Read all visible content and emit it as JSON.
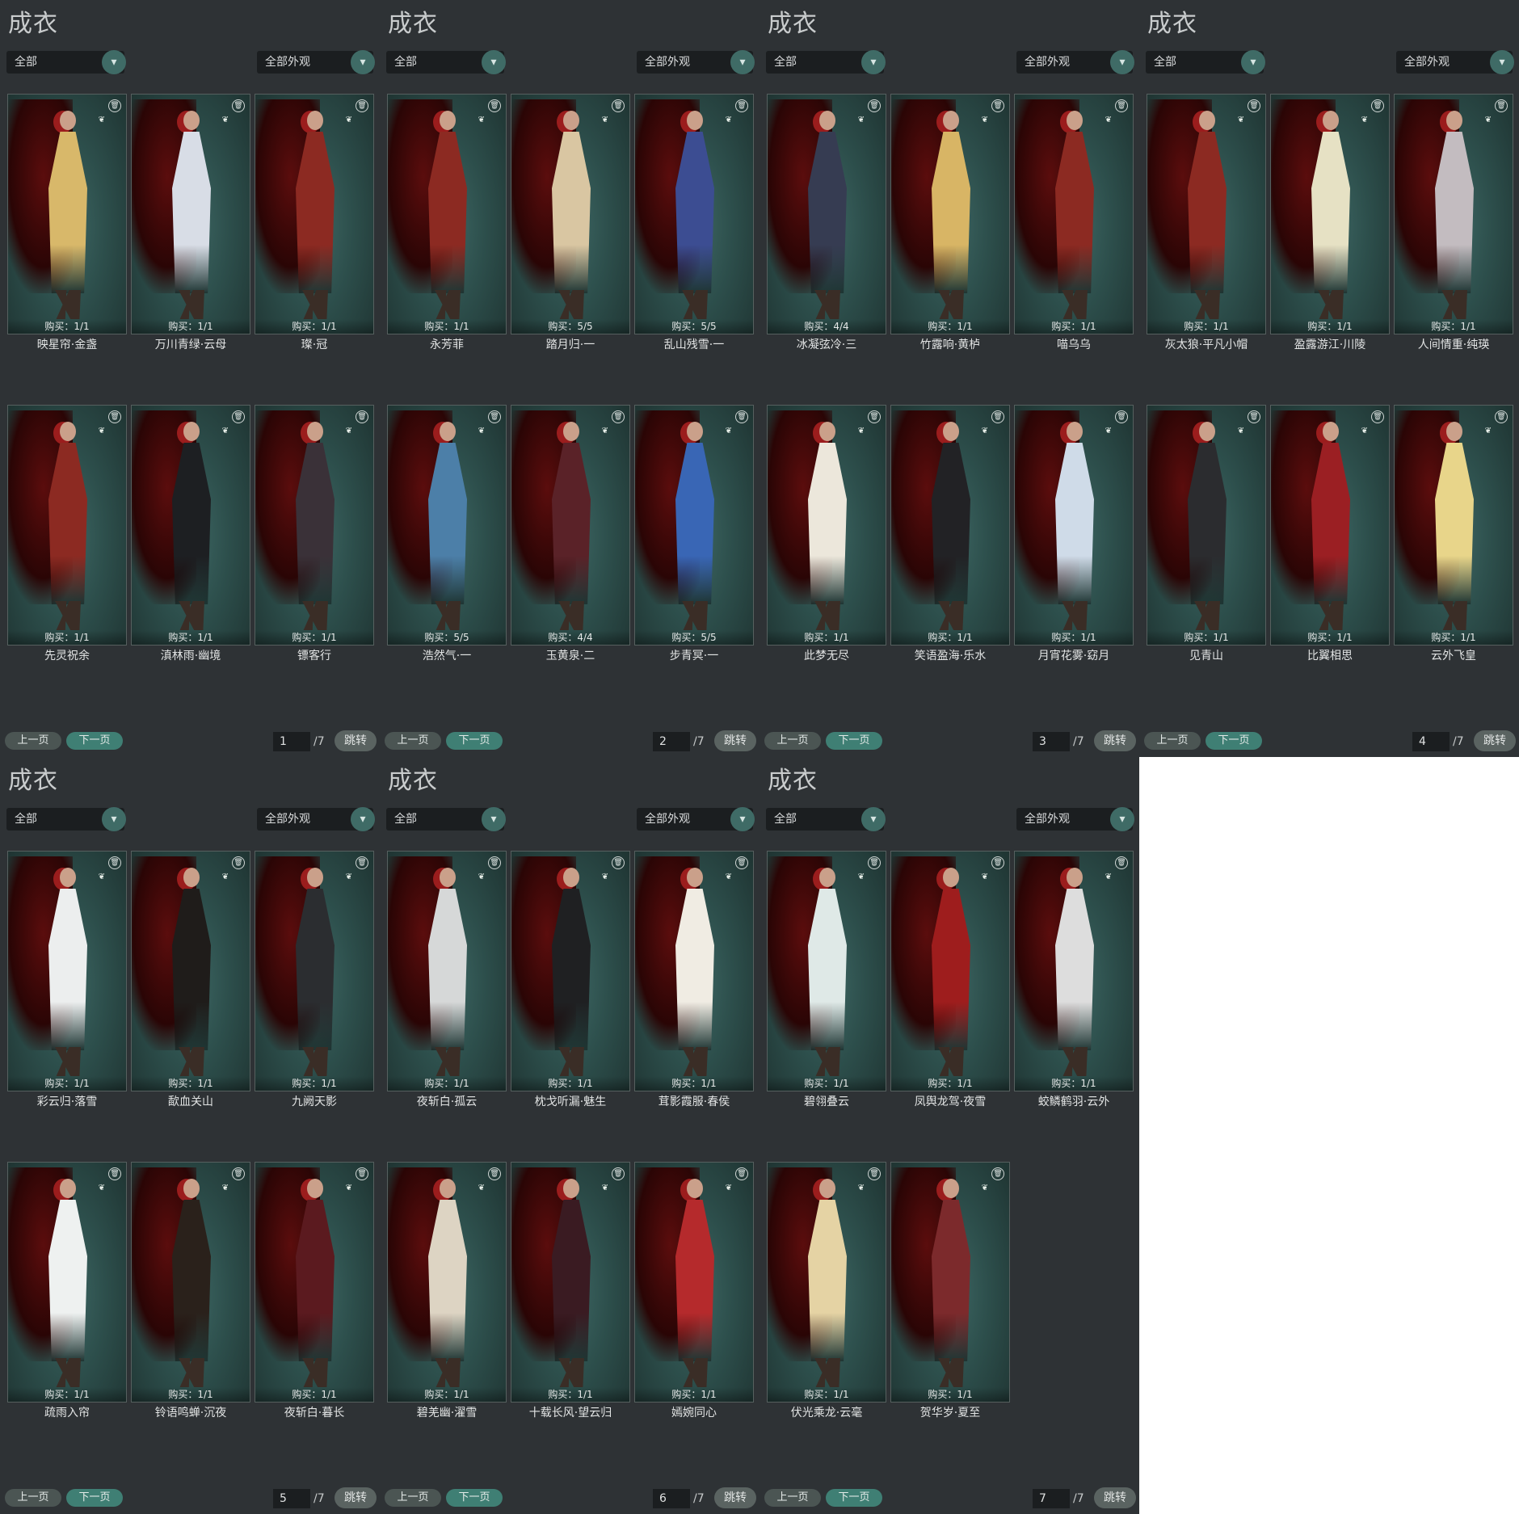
{
  "panels": [
    {
      "title": "成衣",
      "filter_left": "全部",
      "filter_right": "全部外观",
      "items": [
        {
          "name": "映星帘·金盏",
          "buy": "购买：1/1",
          "color": "#d8b86a"
        },
        {
          "name": "万川青绿·云母",
          "buy": "购买：1/1",
          "color": "#d8dde6"
        },
        {
          "name": "璨·冠",
          "buy": "购买：1/1",
          "color": "#8c2a22"
        },
        {
          "name": "先灵祝余",
          "buy": "购买：1/1",
          "color": "#8c2a22"
        },
        {
          "name": "滇林雨·幽境",
          "buy": "购买：1/1",
          "color": "#1d1f22"
        },
        {
          "name": "镖客行",
          "buy": "购买：1/1",
          "color": "#3a3138"
        }
      ],
      "page": "1",
      "total": "/7"
    },
    {
      "title": "成衣",
      "filter_left": "全部",
      "filter_right": "全部外观",
      "items": [
        {
          "name": "永芳菲",
          "buy": "购买：1/1",
          "color": "#8c2a22"
        },
        {
          "name": "踏月归·一",
          "buy": "购买：5/5",
          "color": "#d9c6a2"
        },
        {
          "name": "乱山残雪·一",
          "buy": "购买：5/5",
          "color": "#3c4d92"
        },
        {
          "name": "浩然气·一",
          "buy": "购买：5/5",
          "color": "#4c7fa8"
        },
        {
          "name": "玉黄泉·二",
          "buy": "购买：4/4",
          "color": "#5a2228"
        },
        {
          "name": "步青冥·一",
          "buy": "购买：5/5",
          "color": "#3966b5"
        }
      ],
      "page": "2",
      "total": "/7"
    },
    {
      "title": "成衣",
      "filter_left": "全部",
      "filter_right": "全部外观",
      "items": [
        {
          "name": "冰凝弦冷·三",
          "buy": "购买：4/4",
          "color": "#363c52"
        },
        {
          "name": "竹露响·黄栌",
          "buy": "购买：1/1",
          "color": "#d8b565"
        },
        {
          "name": "喵乌乌",
          "buy": "购买：1/1",
          "color": "#8c2a22"
        },
        {
          "name": "此梦无尽",
          "buy": "购买：1/1",
          "color": "#ece7db"
        },
        {
          "name": "笑语盈海·乐水",
          "buy": "购买：1/1",
          "color": "#222225"
        },
        {
          "name": "月宵花雾·窈月",
          "buy": "购买：1/1",
          "color": "#cfdbe8"
        }
      ],
      "page": "3",
      "total": "/7"
    },
    {
      "title": "成衣",
      "filter_left": "全部",
      "filter_right": "全部外观",
      "items": [
        {
          "name": "灰太狼·平凡小帽",
          "buy": "购买：1/1",
          "color": "#8c2a22"
        },
        {
          "name": "盈露游江·川陵",
          "buy": "购买：1/1",
          "color": "#e6e1c4"
        },
        {
          "name": "人间情重·纯瑛",
          "buy": "购买：1/1",
          "color": "#c3bcc0"
        },
        {
          "name": "见青山",
          "buy": "购买：1/1",
          "color": "#2b2c2f"
        },
        {
          "name": "比翼相思",
          "buy": "购买：1/1",
          "color": "#9b1f23"
        },
        {
          "name": "云外飞皇",
          "buy": "购买：1/1",
          "color": "#e8d58a"
        }
      ],
      "page": "4",
      "total": "/7"
    },
    {
      "title": "成衣",
      "filter_left": "全部",
      "filter_right": "全部外观",
      "items": [
        {
          "name": "彩云归·落雪",
          "buy": "购买：1/1",
          "color": "#eceeee"
        },
        {
          "name": "歃血关山",
          "buy": "购买：1/1",
          "color": "#1f1c1a"
        },
        {
          "name": "九阙天影",
          "buy": "购买：1/1",
          "color": "#2b2d30"
        },
        {
          "name": "疏雨入帘",
          "buy": "购买：1/1",
          "color": "#eef1f0"
        },
        {
          "name": "铃语鸣蝉·沉夜",
          "buy": "购买：1/1",
          "color": "#2a211b"
        },
        {
          "name": "夜斩白·暮长",
          "buy": "购买：1/1",
          "color": "#5b1a1f"
        }
      ],
      "page": "5",
      "total": "/7"
    },
    {
      "title": "成衣",
      "filter_left": "全部",
      "filter_right": "全部外观",
      "items": [
        {
          "name": "夜斩白·孤云",
          "buy": "购买：1/1",
          "color": "#d6d8d8"
        },
        {
          "name": "枕戈听漏·魅生",
          "buy": "购买：1/1",
          "color": "#1f2022"
        },
        {
          "name": "茸影霞服·春侯",
          "buy": "购买：1/1",
          "color": "#f0ece3"
        },
        {
          "name": "碧羌幽·濯雪",
          "buy": "购买：1/1",
          "color": "#ddd4c3"
        },
        {
          "name": "十载长风·望云归",
          "buy": "购买：1/1",
          "color": "#3a1b22"
        },
        {
          "name": "嫣婉同心",
          "buy": "购买：1/1",
          "color": "#b52a2c"
        }
      ],
      "page": "6",
      "total": "/7"
    },
    {
      "title": "成衣",
      "filter_left": "全部",
      "filter_right": "全部外观",
      "items": [
        {
          "name": "碧翎叠云",
          "buy": "购买：1/1",
          "color": "#dfe9e7"
        },
        {
          "name": "凤舆龙驾·夜雪",
          "buy": "购买：1/1",
          "color": "#9e1d1d"
        },
        {
          "name": "蛟鳞鹤羽·云外",
          "buy": "购买：1/1",
          "color": "#dddddd"
        },
        {
          "name": "伏光乘龙·云毫",
          "buy": "购买：1/1",
          "color": "#e5d3a4"
        },
        {
          "name": "贺华岁·夏至",
          "buy": "购买：1/1",
          "color": "#7c2a2c"
        }
      ],
      "page": "7",
      "total": "/7"
    }
  ],
  "labels": {
    "prev": "上一页",
    "next": "下一页",
    "jump": "跳转",
    "trash_icon": "🗑",
    "arrow_icon": "▾",
    "butterfly_icon": "❦"
  }
}
